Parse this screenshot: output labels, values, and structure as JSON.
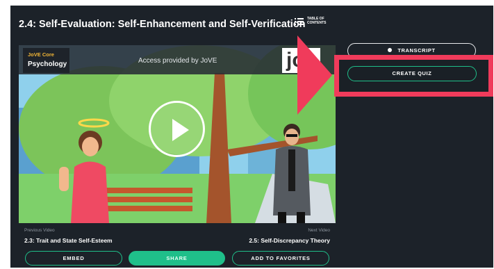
{
  "page": {
    "title": "2.4: Self-Evaluation: Self-Enhancement and Self-Verification",
    "toc": {
      "icon": "list-icon",
      "label_line1": "TABLE OF",
      "label_line2": "CONTENTS"
    }
  },
  "video": {
    "core_label": "JoVE Core",
    "subject": "Psychology",
    "access_text": "Access provided by JoVE",
    "logo_text": "jo",
    "play_icon": "play-icon"
  },
  "navigation": {
    "previous_label": "Previous Video",
    "previous_title": "2.3: Trait and State Self-Esteem",
    "next_label": "Next Video",
    "next_title": "2.5: Self-Discrepancy Theory"
  },
  "actions": {
    "embed": "EMBED",
    "share": "SHARE",
    "favorites": "ADD TO FAVORITES",
    "transcript": "TRANSCRIPT",
    "create_quiz": "CREATE QUIZ"
  },
  "colors": {
    "background": "#1c2229",
    "accent_green": "#1fbf8a",
    "highlight_red": "#f03b5b",
    "core_label_yellow": "#f2b636"
  }
}
